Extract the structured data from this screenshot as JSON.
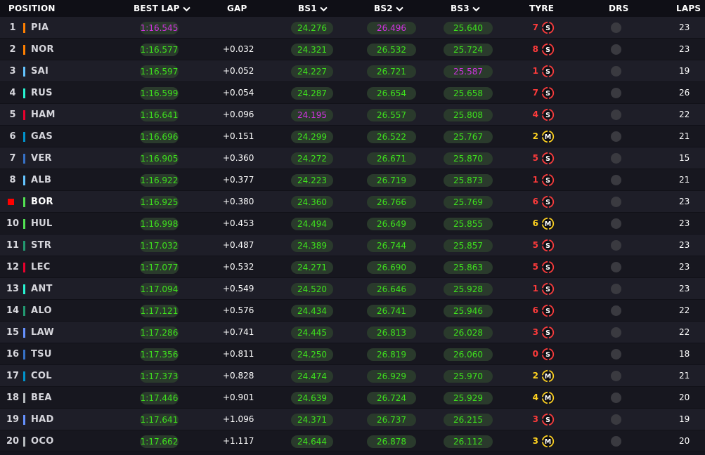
{
  "colors": {
    "green": "#3ee21d",
    "purple": "#d233e3",
    "soft_tyre": "#ff3b3b",
    "medium_tyre": "#ffd21f"
  },
  "header": {
    "position": "POSITION",
    "best_lap": "BEST LAP",
    "gap": "GAP",
    "bs1": "BS1",
    "bs2": "BS2",
    "bs3": "BS3",
    "tyre": "TYRE",
    "drs": "DRS",
    "laps": "LAPS"
  },
  "rows": [
    {
      "pos": "1",
      "drv": "PIA",
      "team_color": "#ff8000",
      "best": "1:16.545",
      "best_purple": true,
      "gap": "",
      "bs1": "24.276",
      "bs1_purple": false,
      "bs2": "26.496",
      "bs2_purple": true,
      "bs3": "25.640",
      "bs3_purple": false,
      "tyre_age": "7",
      "tyre": "S",
      "laps": "23"
    },
    {
      "pos": "2",
      "drv": "NOR",
      "team_color": "#ff8000",
      "best": "1:16.577",
      "gap": "+0.032",
      "bs1": "24.321",
      "bs2": "26.532",
      "bs3": "25.724",
      "tyre_age": "8",
      "tyre": "S",
      "laps": "23"
    },
    {
      "pos": "3",
      "drv": "SAI",
      "team_color": "#64c4ff",
      "best": "1:16.597",
      "gap": "+0.052",
      "bs1": "24.227",
      "bs2": "26.721",
      "bs3": "25.587",
      "bs3_purple": true,
      "tyre_age": "1",
      "tyre": "S",
      "laps": "19"
    },
    {
      "pos": "4",
      "drv": "RUS",
      "team_color": "#27f4d2",
      "best": "1:16.599",
      "gap": "+0.054",
      "bs1": "24.287",
      "bs2": "26.654",
      "bs3": "25.658",
      "tyre_age": "7",
      "tyre": "S",
      "laps": "26"
    },
    {
      "pos": "5",
      "drv": "HAM",
      "team_color": "#e8002d",
      "best": "1:16.641",
      "gap": "+0.096",
      "bs1": "24.195",
      "bs1_purple": true,
      "bs2": "26.557",
      "bs3": "25.808",
      "tyre_age": "4",
      "tyre": "S",
      "laps": "22"
    },
    {
      "pos": "6",
      "drv": "GAS",
      "team_color": "#0093cc",
      "best": "1:16.696",
      "gap": "+0.151",
      "bs1": "24.299",
      "bs2": "26.522",
      "bs3": "25.767",
      "tyre_age": "2",
      "tyre": "M",
      "laps": "21"
    },
    {
      "pos": "7",
      "drv": "VER",
      "team_color": "#3671c6",
      "best": "1:16.905",
      "gap": "+0.360",
      "bs1": "24.272",
      "bs2": "26.671",
      "bs3": "25.870",
      "tyre_age": "5",
      "tyre": "S",
      "laps": "15"
    },
    {
      "pos": "8",
      "drv": "ALB",
      "team_color": "#64c4ff",
      "best": "1:16.922",
      "gap": "+0.377",
      "bs1": "24.223",
      "bs2": "26.719",
      "bs3": "25.873",
      "tyre_age": "1",
      "tyre": "S",
      "laps": "21"
    },
    {
      "pos": "",
      "drv": "BOR",
      "team_color": "#52e252",
      "flag": true,
      "selected": true,
      "best": "1:16.925",
      "gap": "+0.380",
      "bs1": "24.360",
      "bs2": "26.766",
      "bs3": "25.769",
      "tyre_age": "6",
      "tyre": "S",
      "laps": "23"
    },
    {
      "pos": "10",
      "drv": "HUL",
      "team_color": "#52e252",
      "best": "1:16.998",
      "gap": "+0.453",
      "bs1": "24.494",
      "bs2": "26.649",
      "bs3": "25.855",
      "tyre_age": "6",
      "tyre": "M",
      "laps": "23"
    },
    {
      "pos": "11",
      "drv": "STR",
      "team_color": "#229971",
      "best": "1:17.032",
      "gap": "+0.487",
      "bs1": "24.389",
      "bs2": "26.744",
      "bs3": "25.857",
      "tyre_age": "5",
      "tyre": "S",
      "laps": "23"
    },
    {
      "pos": "12",
      "drv": "LEC",
      "team_color": "#e8002d",
      "best": "1:17.077",
      "gap": "+0.532",
      "bs1": "24.271",
      "bs2": "26.690",
      "bs3": "25.863",
      "tyre_age": "5",
      "tyre": "S",
      "laps": "23"
    },
    {
      "pos": "13",
      "drv": "ANT",
      "team_color": "#27f4d2",
      "best": "1:17.094",
      "gap": "+0.549",
      "bs1": "24.520",
      "bs2": "26.646",
      "bs3": "25.928",
      "tyre_age": "1",
      "tyre": "S",
      "laps": "23"
    },
    {
      "pos": "14",
      "drv": "ALO",
      "team_color": "#229971",
      "best": "1:17.121",
      "gap": "+0.576",
      "bs1": "24.434",
      "bs2": "26.741",
      "bs3": "25.946",
      "tyre_age": "6",
      "tyre": "S",
      "laps": "22"
    },
    {
      "pos": "15",
      "drv": "LAW",
      "team_color": "#6692ff",
      "best": "1:17.286",
      "gap": "+0.741",
      "bs1": "24.445",
      "bs2": "26.813",
      "bs3": "26.028",
      "tyre_age": "3",
      "tyre": "S",
      "laps": "22"
    },
    {
      "pos": "16",
      "drv": "TSU",
      "team_color": "#3671c6",
      "best": "1:17.356",
      "gap": "+0.811",
      "bs1": "24.250",
      "bs2": "26.819",
      "bs3": "26.060",
      "tyre_age": "0",
      "tyre": "S",
      "laps": "18"
    },
    {
      "pos": "17",
      "drv": "COL",
      "team_color": "#0093cc",
      "best": "1:17.373",
      "gap": "+0.828",
      "bs1": "24.474",
      "bs2": "26.929",
      "bs3": "25.970",
      "tyre_age": "2",
      "tyre": "M",
      "laps": "21"
    },
    {
      "pos": "18",
      "drv": "BEA",
      "team_color": "#b6babd",
      "best": "1:17.446",
      "gap": "+0.901",
      "bs1": "24.639",
      "bs2": "26.724",
      "bs3": "25.929",
      "tyre_age": "4",
      "tyre": "M",
      "laps": "20"
    },
    {
      "pos": "19",
      "drv": "HAD",
      "team_color": "#6692ff",
      "best": "1:17.641",
      "gap": "+1.096",
      "bs1": "24.371",
      "bs2": "26.737",
      "bs3": "26.215",
      "tyre_age": "3",
      "tyre": "S",
      "laps": "19"
    },
    {
      "pos": "20",
      "drv": "OCO",
      "team_color": "#b6babd",
      "best": "1:17.662",
      "gap": "+1.117",
      "bs1": "24.644",
      "bs2": "26.878",
      "bs3": "26.112",
      "tyre_age": "3",
      "tyre": "M",
      "laps": "20"
    }
  ]
}
